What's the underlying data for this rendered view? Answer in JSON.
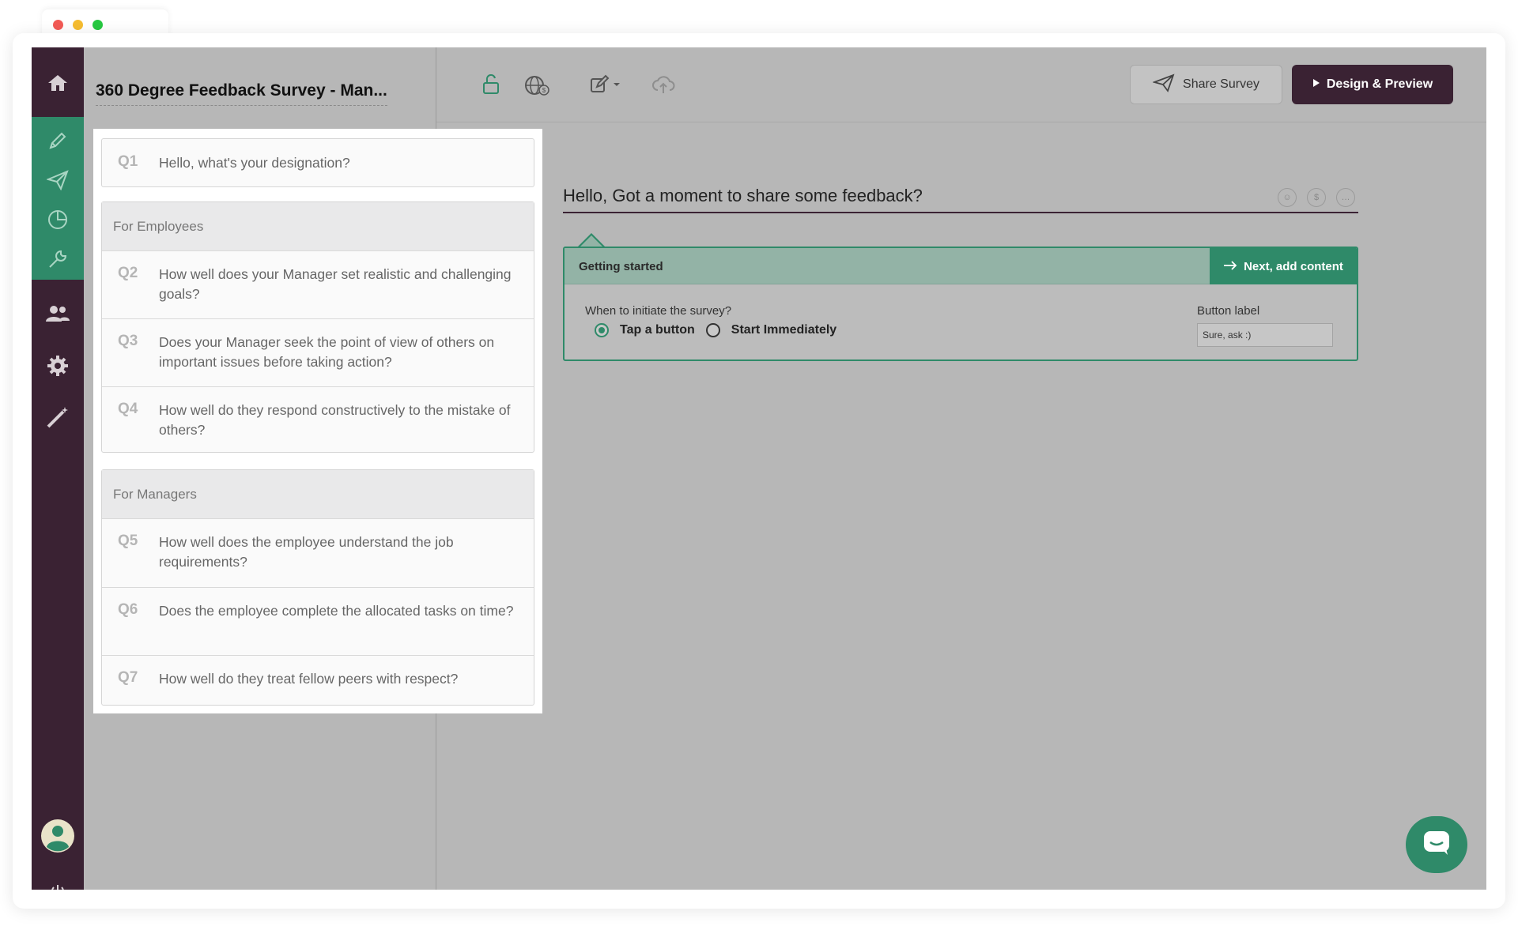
{
  "survey": {
    "title": "360 Degree Feedback Survey - Man..."
  },
  "toolbar": {
    "share_label": "Share Survey",
    "design_label": "Design & Preview"
  },
  "questions": {
    "q1": {
      "num": "Q1",
      "text": "Hello, what's your designation?"
    },
    "section1": "For Employees",
    "q2": {
      "num": "Q2",
      "text": "How well does your Manager set realistic and challenging goals?"
    },
    "q3": {
      "num": "Q3",
      "text": "Does your Manager seek the point of view of others on important issues before taking action?"
    },
    "q4": {
      "num": "Q4",
      "text": "How well do they respond constructively to the mistake of others?"
    },
    "section2": "For Managers",
    "q5": {
      "num": "Q5",
      "text": "How well does the employee understand the job requirements?"
    },
    "q6": {
      "num": "Q6",
      "text": "Does the employee complete the allocated tasks on time?"
    },
    "q7": {
      "num": "Q7",
      "text": "How well do they treat fellow peers with respect?"
    }
  },
  "editor": {
    "heading": "Hello, Got a moment to share some feedback?",
    "getting_started": "Getting started",
    "next_label": "Next, add content",
    "initiate_label": "When to initiate the survey?",
    "option_tap": "Tap a button",
    "option_start": "Start Immediately",
    "selected_option": "Tap a button",
    "button_label_caption": "Button label",
    "button_label_value": "Sure, ask :)"
  },
  "icons": {
    "nav": [
      "home-icon",
      "pencil-icon",
      "send-icon",
      "reports-icon",
      "wrench-icon",
      "users-icon",
      "gear-icon",
      "magic-wand-icon",
      "avatar-icon",
      "power-icon"
    ],
    "topbar": [
      "unlock-icon",
      "globe-icon",
      "edit-icon",
      "cloud-upload-icon"
    ]
  },
  "colors": {
    "nav_bg": "#3a2233",
    "accent": "#2f8a69",
    "overlay_gray": "#b7b7b7"
  }
}
